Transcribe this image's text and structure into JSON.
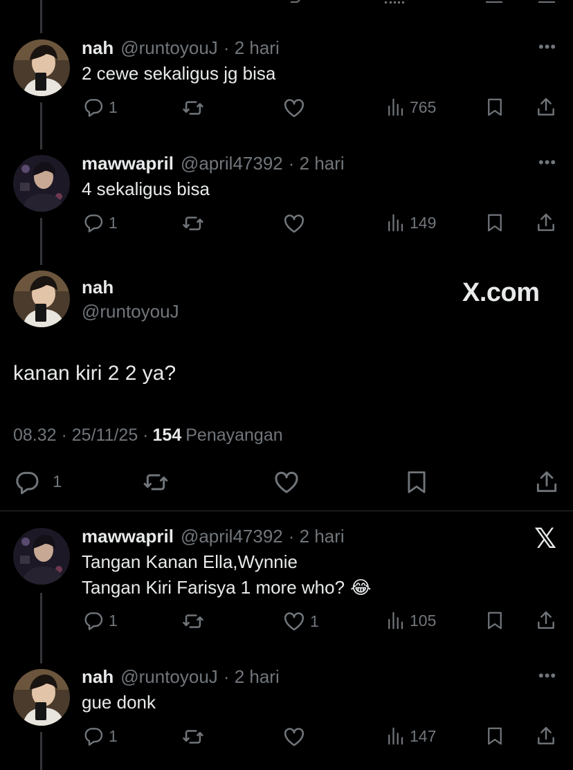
{
  "replies_top": [
    {
      "name": "nah",
      "handle": "@runtoyouJ",
      "time": "· 2 hari",
      "text": "2 cewe sekaligus jg bisa",
      "replies": "1",
      "likes": "",
      "views": "765"
    },
    {
      "name": "mawwapril",
      "handle": "@april47392",
      "time": "· 2 hari",
      "text": "4 sekaligus bisa",
      "replies": "1",
      "likes": "",
      "views": "149"
    }
  ],
  "main_post": {
    "name": "nah",
    "handle": "@runtoyouJ",
    "text": "kanan kiri 2 2 ya?",
    "time": "08.32 · 25/11/25 ·",
    "views_count": "154",
    "views_label": "Penayangan",
    "replies": "1",
    "watermark": "X.com"
  },
  "replies_bottom": [
    {
      "name": "mawwapril",
      "handle": "@april47392",
      "time": "· 2 hari",
      "line1": "Tangan Kanan Ella,Wynnie",
      "line2": "Tangan Kiri Farisya 1 more who?",
      "emoji": "😂",
      "replies": "1",
      "likes": "1",
      "views": "105"
    },
    {
      "name": "nah",
      "handle": "@runtoyouJ",
      "time": "· 2 hari",
      "text": "gue donk",
      "replies": "1",
      "likes": "",
      "views": "147"
    }
  ],
  "colors": {
    "background": "#000000",
    "text": "#e7e9ea",
    "muted": "#71767b",
    "divider": "#2f3336"
  },
  "icons": [
    "reply-icon",
    "retweet-icon",
    "like-icon",
    "views-icon",
    "bookmark-icon",
    "share-icon",
    "more-icon",
    "x-logo-icon"
  ]
}
